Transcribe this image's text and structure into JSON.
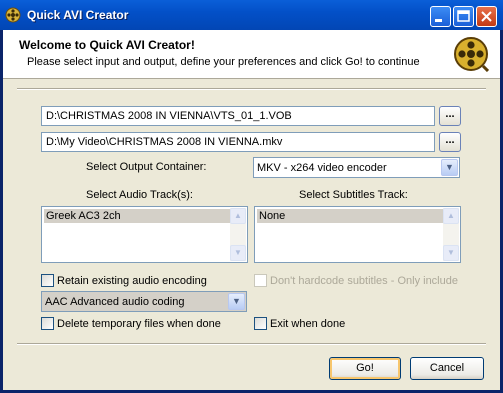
{
  "window": {
    "title": "Quick AVI Creator"
  },
  "header": {
    "title": "Welcome to Quick AVI Creator!",
    "subtitle": "Please select input and output, define your preferences and click Go! to continue"
  },
  "input_path": "D:\\CHRISTMAS 2008 IN VIENNA\\VTS_01_1.VOB",
  "output_path": "D:\\My Video\\CHRISTMAS 2008 IN VIENNA.mkv",
  "browse_label": "...",
  "output_container": {
    "label": "Select Output Container:",
    "value": "MKV - x264 video encoder"
  },
  "audio": {
    "label": "Select Audio Track(s):",
    "items": [
      "Greek AC3 2ch"
    ]
  },
  "subtitles": {
    "label": "Select Subtitles Track:",
    "items": [
      "None"
    ]
  },
  "options": {
    "retain_audio": {
      "label": "Retain existing audio encoding",
      "checked": false
    },
    "audio_codec": "AAC Advanced audio coding",
    "dont_hardcode": {
      "label": "Don't hardcode subtitles - Only include",
      "checked": false,
      "disabled": true
    },
    "delete_temp": {
      "label": "Delete temporary files when done",
      "checked": false
    },
    "exit_when_done": {
      "label": "Exit when done",
      "checked": false
    }
  },
  "buttons": {
    "go": "Go!",
    "cancel": "Cancel"
  },
  "colors": {
    "titlebar": "#0350c8",
    "accent": "#f7c66d",
    "header_bg": "#ffffff",
    "dialog_bg": "#ece9d8"
  }
}
